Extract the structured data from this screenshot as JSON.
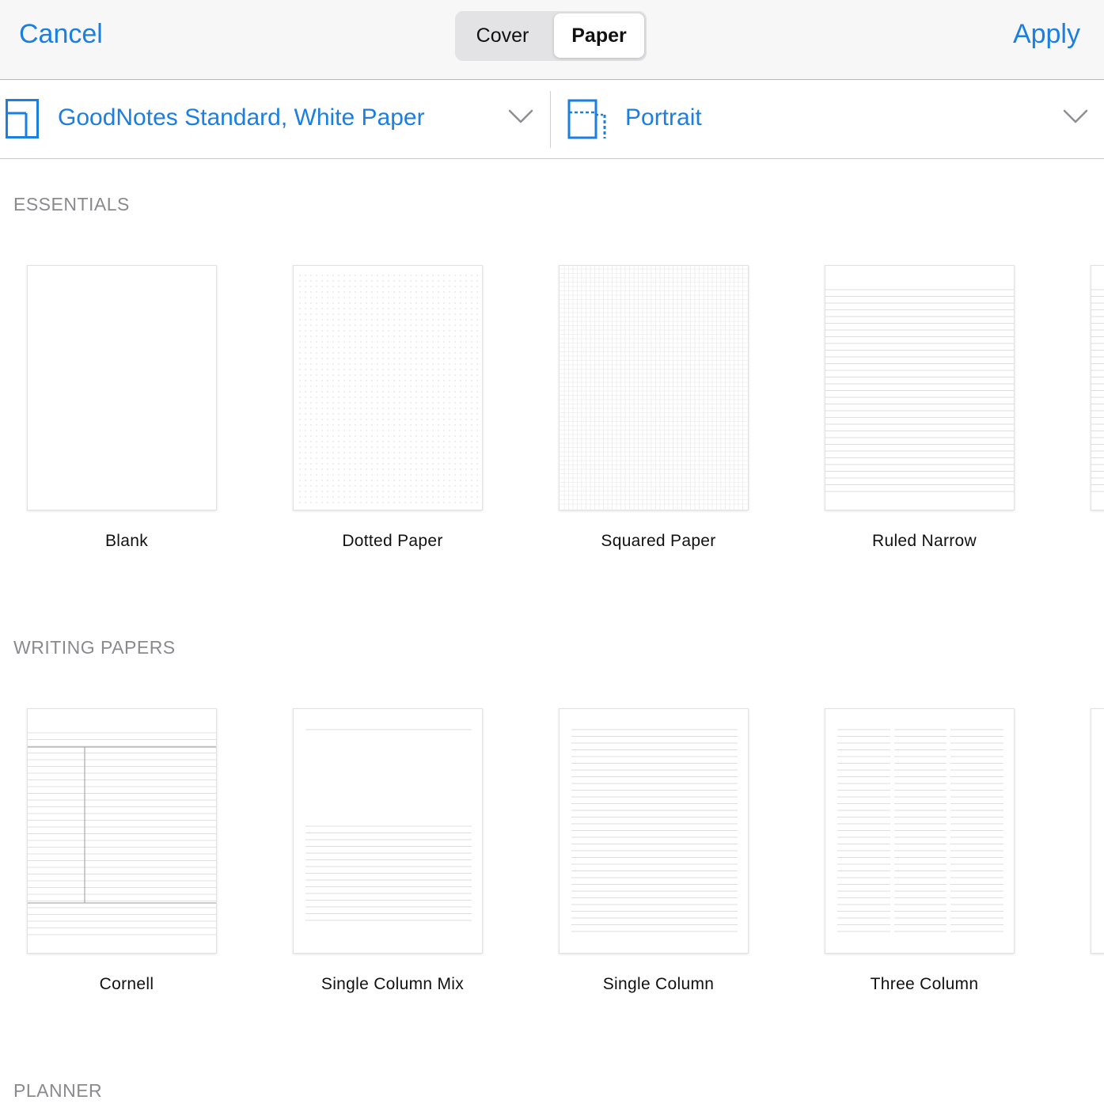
{
  "header": {
    "cancel_label": "Cancel",
    "apply_label": "Apply",
    "segments": [
      "Cover",
      "Paper"
    ],
    "selected_segment": "Paper"
  },
  "selectors": {
    "template_label": "GoodNotes Standard, White Paper",
    "orientation_label": "Portrait"
  },
  "sections": [
    {
      "title": "ESSENTIALS",
      "items": [
        {
          "label": "Blank",
          "pattern": "blank"
        },
        {
          "label": "Dotted Paper",
          "pattern": "dotted"
        },
        {
          "label": "Squared Paper",
          "pattern": "squared"
        },
        {
          "label": "Ruled Narrow",
          "pattern": "ruled"
        }
      ]
    },
    {
      "title": "WRITING PAPERS",
      "items": [
        {
          "label": "Cornell",
          "pattern": "cornell"
        },
        {
          "label": "Single Column Mix",
          "pattern": "single-column-mix"
        },
        {
          "label": "Single Column",
          "pattern": "single-column"
        },
        {
          "label": "Three Column",
          "pattern": "three-column"
        }
      ]
    },
    {
      "title": "PLANNER",
      "items": []
    }
  ],
  "colors": {
    "accent": "#1a7fe0",
    "section_title": "#8a8a8e",
    "paper_line": "#dcdcdc"
  }
}
